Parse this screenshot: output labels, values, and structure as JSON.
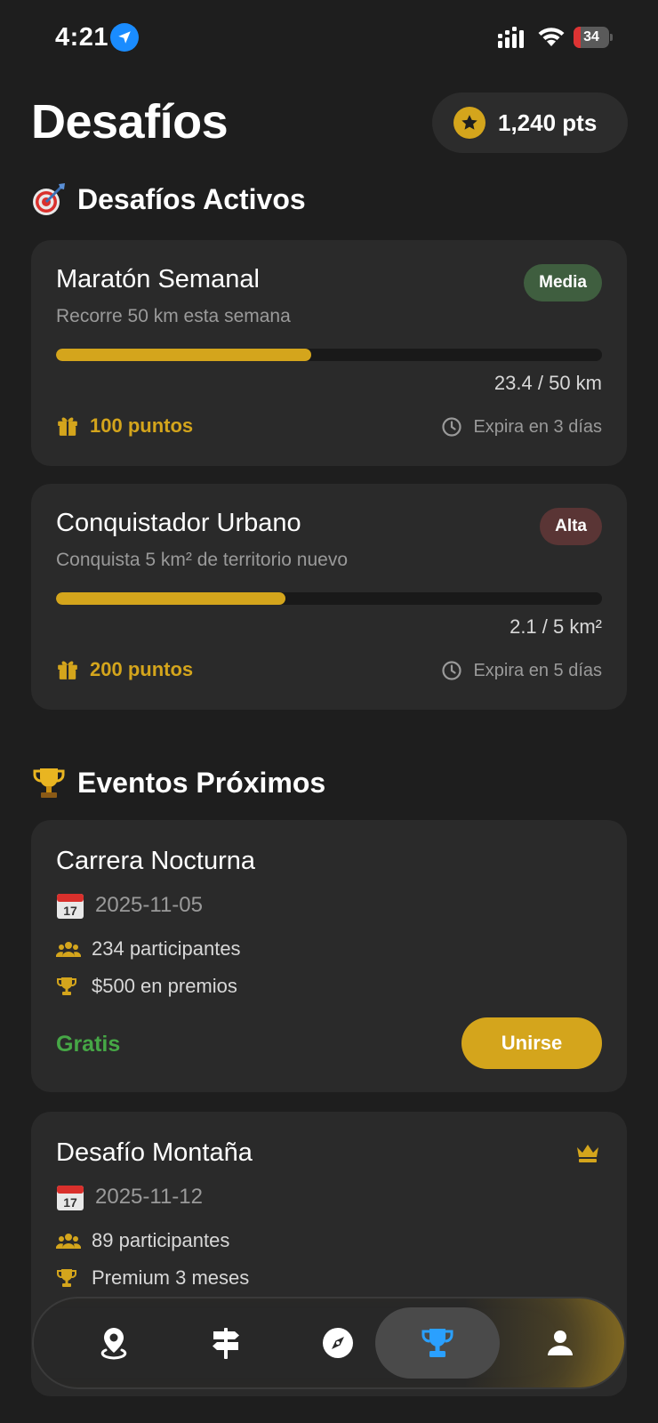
{
  "status_bar": {
    "time": "4:21",
    "battery": "34"
  },
  "header": {
    "title": "Desafíos",
    "points": "1,240 pts"
  },
  "active_section": {
    "title": "Desafíos Activos",
    "challenges": [
      {
        "title": "Maratón Semanal",
        "description": "Recorre 50 km esta semana",
        "difficulty": "Media",
        "progress_fraction": 0.468,
        "progress_label": "23.4 / 50 km",
        "reward": "100 puntos",
        "expiry": "Expira en 3 días"
      },
      {
        "title": "Conquistador Urbano",
        "description": "Conquista 5 km² de territorio nuevo",
        "difficulty": "Alta",
        "progress_fraction": 0.42,
        "progress_label": "2.1 / 5 km²",
        "reward": "200 puntos",
        "expiry": "Expira en 5 días"
      }
    ]
  },
  "events_section": {
    "title": "Eventos Próximos",
    "events": [
      {
        "title": "Carrera Nocturna",
        "date": "2025-11-05",
        "participants": "234 participantes",
        "prize": "$500 en premios",
        "price": "Gratis",
        "action": "Unirse"
      },
      {
        "title": "Desafío Montaña",
        "date": "2025-11-12",
        "participants": "89 participantes",
        "prize": "Premium 3 meses",
        "premium": true
      }
    ]
  },
  "tab_bar": {
    "tabs": [
      {
        "icon": "map-pin-icon",
        "active": false
      },
      {
        "icon": "signpost-icon",
        "active": false
      },
      {
        "icon": "compass-icon",
        "active": false
      },
      {
        "icon": "trophy-icon",
        "active": true
      },
      {
        "icon": "profile-icon",
        "active": false
      }
    ]
  },
  "colors": {
    "background": "#1e1e1e",
    "card": "#2a2a2a",
    "accent": "#d4a51c",
    "free": "#46a746",
    "active_tab": "#2aa0ff"
  }
}
